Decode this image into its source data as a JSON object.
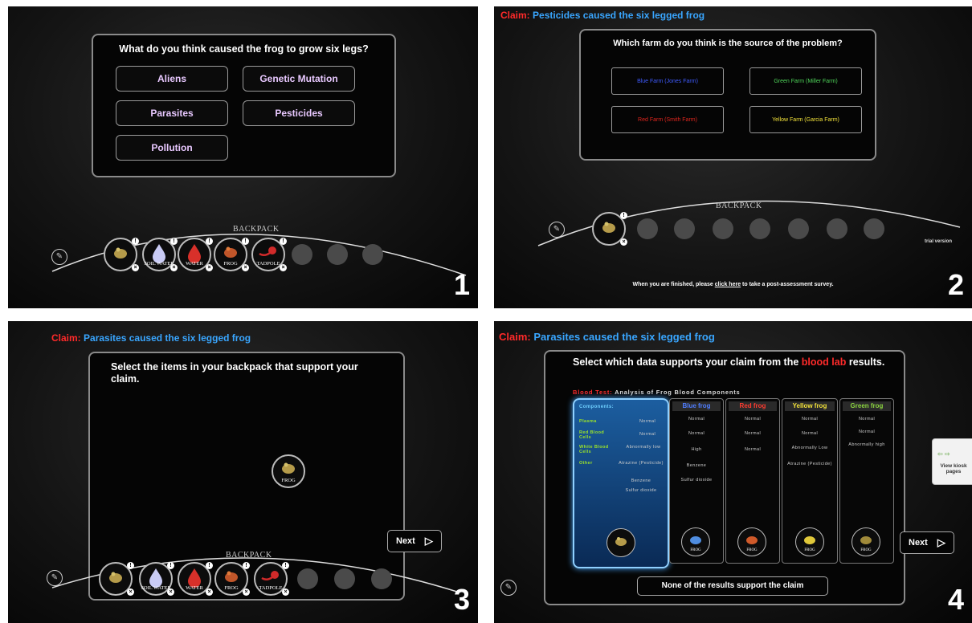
{
  "panel_numbers": [
    "1",
    "2",
    "3",
    "4"
  ],
  "panel1": {
    "question": "What do you think caused the frog to grow six legs?",
    "options": [
      "Aliens",
      "Genetic Mutation",
      "Parasites",
      "Pesticides",
      "Pollution"
    ],
    "backpack_label": "BACKPACK",
    "items": [
      "SIX LEGGED FROG",
      "SOIL WATER",
      "WATER",
      "FROG",
      "TADPOLE"
    ]
  },
  "panel2": {
    "claim_label": "Claim:",
    "claim_text": "Pesticides caused the six legged frog",
    "question": "Which farm do you think is the source of the problem?",
    "farms": [
      {
        "label": "Blue Farm (Jones Farm)",
        "color": "#3f5bff"
      },
      {
        "label": "Green Farm (Miller Farm)",
        "color": "#4fd45a"
      },
      {
        "label": "Red Farm (Smith Farm)",
        "color": "#e0261e"
      },
      {
        "label": "Yellow Farm (Garcia Farm)",
        "color": "#f2e23a"
      }
    ],
    "backpack_label": "BACKPACK",
    "trial": "trial version",
    "footer_pre": "When you are finished, please ",
    "footer_link": "click here",
    "footer_post": " to take a post-assessment survey."
  },
  "panel3": {
    "claim_label": "Claim:",
    "claim_text": "Parasites caused the six legged frog",
    "instruction": "Select the items in your backpack that support your claim.",
    "selected_item": "FROG",
    "next_label": "Next",
    "backpack_label": "BACKPACK",
    "items": [
      "SIX LEGGED FROG",
      "SOIL WATER",
      "WATER",
      "FROG",
      "TADPOLE"
    ]
  },
  "panel4": {
    "claim_label": "Claim:",
    "claim_text": "Parasites caused the six legged frog",
    "instruction_pre": "Select which data supports your claim from the ",
    "instruction_red": "blood lab",
    "instruction_post": " results.",
    "table_title_red": "Blood Test:",
    "table_title_rest": " Analysis of Frog Blood Components",
    "components_header": "Components:",
    "rows": [
      "Plasma",
      "Red Blood Cells",
      "White Blood Cells",
      "Other"
    ],
    "six_leg_values": [
      "Normal",
      "Normal",
      "Abnormally low",
      "Atrazine (Pesticide)",
      "Benzene",
      "Sulfur dioxide"
    ],
    "columns": [
      {
        "name": "Blue frog",
        "color": "#4f7dff",
        "values": [
          "Normal",
          "Normal",
          "High",
          "Benzene",
          "Sulfur dioxide"
        ]
      },
      {
        "name": "Red frog",
        "color": "#ff3b2f",
        "values": [
          "Normal",
          "Normal",
          "Normal"
        ]
      },
      {
        "name": "Yellow frog",
        "color": "#f2e23a",
        "values": [
          "Normal",
          "Normal",
          "Abnormally Low",
          "Atrazine (Pesticide)"
        ]
      },
      {
        "name": "Green frog",
        "color": "#8bd43f",
        "values": [
          "Normal",
          "Normal",
          "Abnormally high"
        ]
      }
    ],
    "frog_caption": "FROG",
    "six_leg_caption": "SIX LEGGED FROG",
    "none_button": "None of the results support the claim",
    "next_label": "Next",
    "kiosk_label": "View kiosk pages"
  }
}
